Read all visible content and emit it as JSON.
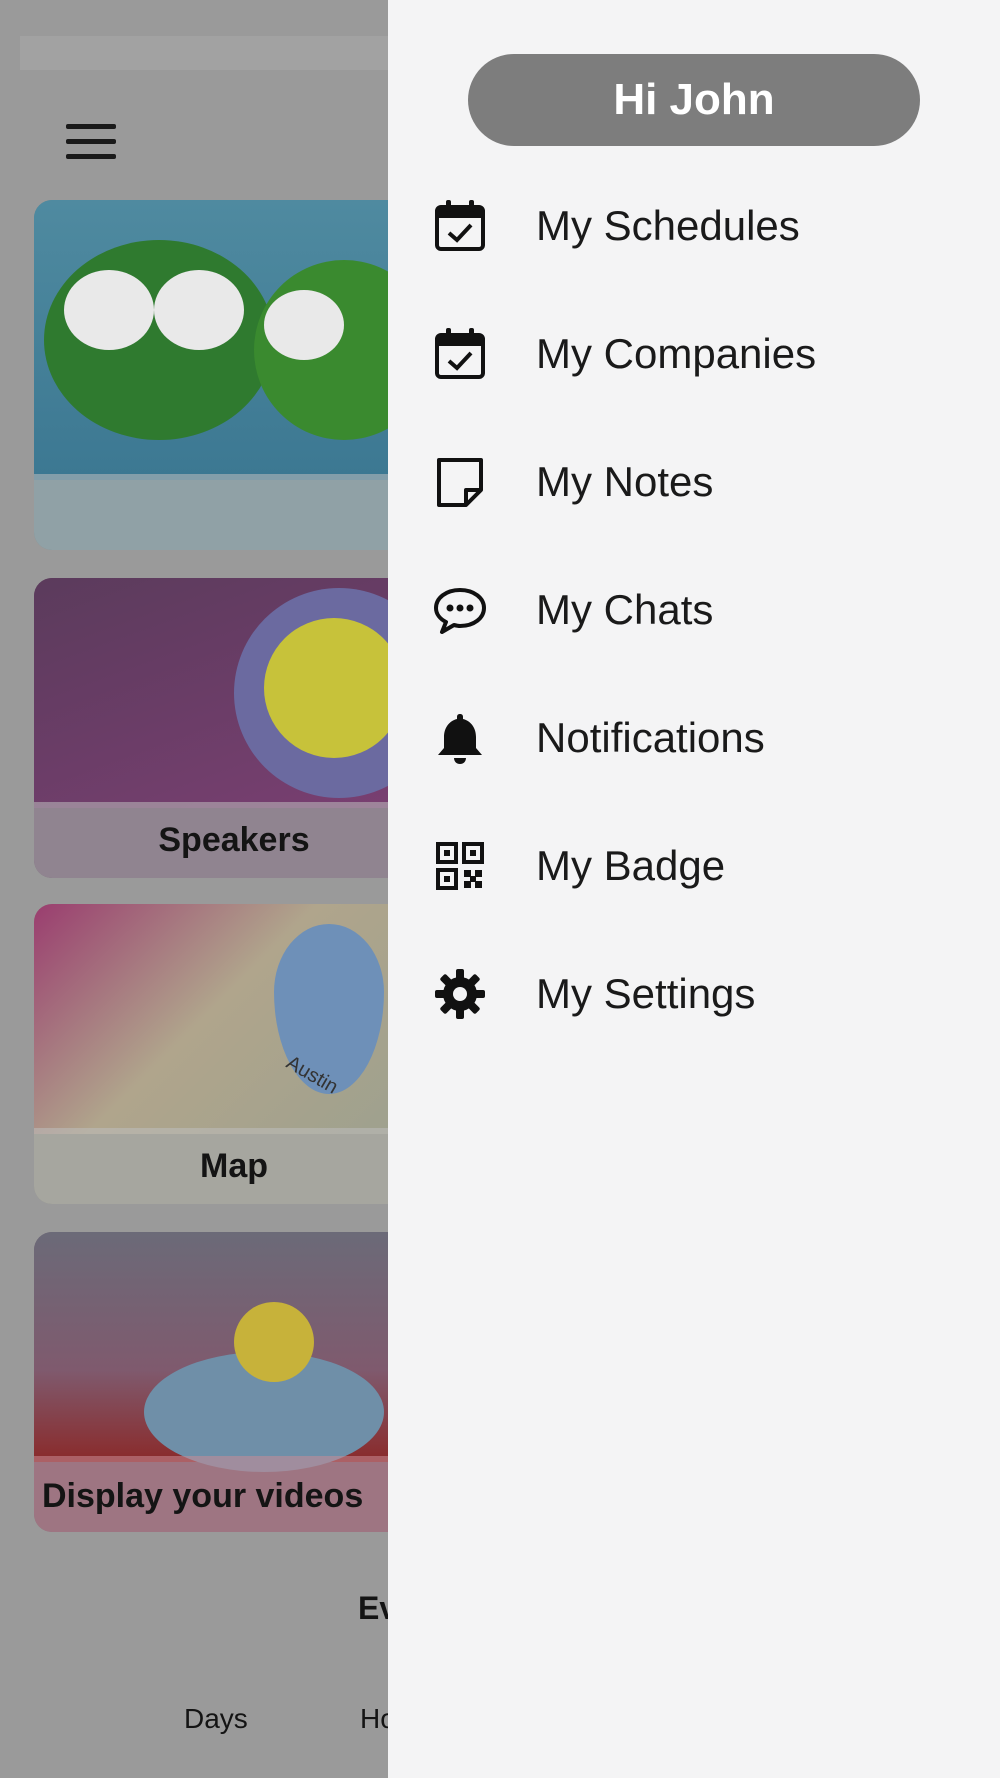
{
  "greeting": "Hi John",
  "menu": [
    {
      "label": "My Schedules",
      "icon": "calendar-check-icon"
    },
    {
      "label": "My Companies",
      "icon": "calendar-check-icon"
    },
    {
      "label": "My Notes",
      "icon": "note-icon"
    },
    {
      "label": "My Chats",
      "icon": "chat-bubble-icon"
    },
    {
      "label": "Notifications",
      "icon": "bell-icon"
    },
    {
      "label": "My Badge",
      "icon": "qr-code-icon"
    },
    {
      "label": "My Settings",
      "icon": "gear-icon"
    }
  ],
  "background": {
    "cards": [
      "",
      "Speakers",
      "Map",
      "Display your videos"
    ],
    "map_text": "Austin",
    "bottom_partial": "Ev",
    "countdown": {
      "days": "Days",
      "hours": "Ho"
    }
  },
  "colors": {
    "drawer_bg": "#f4f4f5",
    "greeting_bg": "#7d7d7d",
    "overlay": "#8a8a8a"
  }
}
